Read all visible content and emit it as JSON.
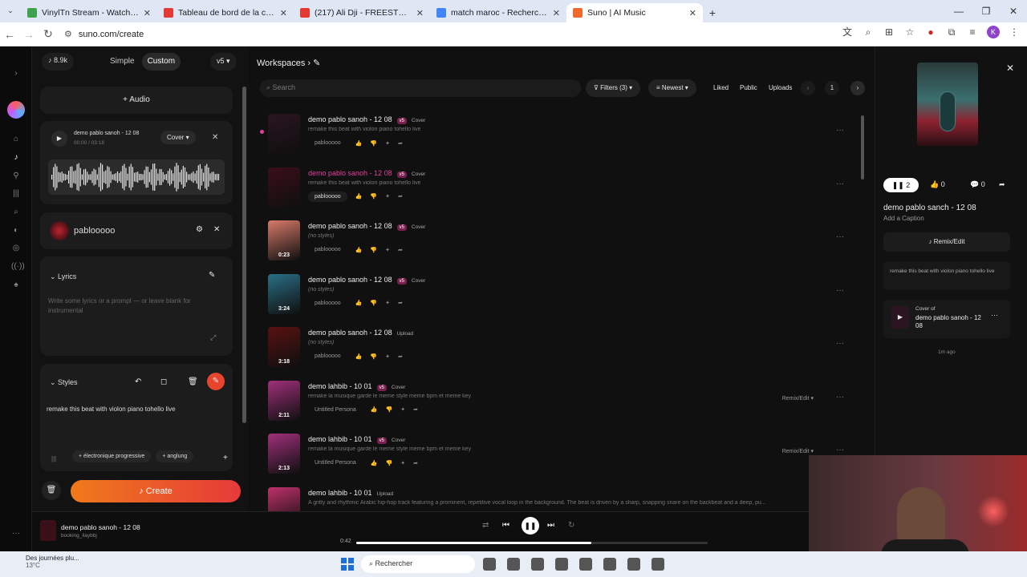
{
  "browser": {
    "tabs": [
      {
        "title": "VinylTn Stream - Watch Live on",
        "color": "#3fa34d",
        "active": false
      },
      {
        "title": "Tableau de bord de la chaîne - Y",
        "color": "#e53935",
        "active": false
      },
      {
        "title": "(217) Ali Dji - FREESTYLE 3 | SAI",
        "color": "#e53935",
        "active": false
      },
      {
        "title": "match maroc - Recherche Goog",
        "color": "#4285f4",
        "active": false
      },
      {
        "title": "Suno | AI Music",
        "color": "#f0692a",
        "active": true
      }
    ],
    "url": "suno.com/create",
    "profile_initial": "K"
  },
  "left_panel": {
    "credits": "8.9k",
    "mode_simple": "Simple",
    "mode_custom": "Custom",
    "version": "v5",
    "audio_button": "Audio",
    "audio_card": {
      "title": "demo pablo sanoh - 12 08",
      "time": "00:00 / 03:18",
      "mode": "Cover"
    },
    "persona_name": "pablooooo",
    "lyrics_label": "Lyrics",
    "lyrics_placeholder": "Write some lyrics or a prompt — or leave blank for instrumental",
    "styles_label": "Styles",
    "styles_text": "remake this beat with violon piano tohello live",
    "style_chips": [
      "électronique progressive",
      "anglung"
    ],
    "create_button": "Create"
  },
  "middle_panel": {
    "breadcrumb": "Workspaces",
    "search_placeholder": "Search",
    "filters": "Filters (3)",
    "sort": "Newest",
    "liked": "Liked",
    "public": "Public",
    "uploads": "Uploads",
    "page": "1",
    "songs": [
      {
        "title": "demo pablo sanoh - 12 08",
        "version": "v5",
        "type": "Cover",
        "desc": "remake this beat with violon piano tohello live",
        "user": "pablooooo",
        "duration": "",
        "highlight": false,
        "thumb": "#2a1520"
      },
      {
        "title": "demo pablo sanoh - 12 08",
        "version": "v5",
        "type": "Cover",
        "desc": "remake this beat with violon piano tohello live",
        "user": "pablooooo",
        "duration": "",
        "highlight": true,
        "thumb": "#3a0f18"
      },
      {
        "title": "demo pablo sanoh - 12 08",
        "version": "v5",
        "type": "Cover",
        "desc": "(no styles)",
        "user": "pablooooo",
        "duration": "0:23",
        "highlight": false,
        "thumb": "#d97a6a"
      },
      {
        "title": "demo pablo sanoh - 12 08",
        "version": "v5",
        "type": "Cover",
        "desc": "(no styles)",
        "user": "pablooooo",
        "duration": "3:24",
        "highlight": false,
        "thumb": "#2a6f86"
      },
      {
        "title": "demo pablo sanoh - 12 08",
        "version": "",
        "type": "Upload",
        "desc": "(no styles)",
        "user": "pablooooo",
        "duration": "3:18",
        "highlight": false,
        "thumb": "#5a1010"
      },
      {
        "title": "demo lahbib - 10 01",
        "version": "v5",
        "type": "Cover",
        "desc": "remake la musique garde le meme style meme bpm et meme key",
        "user": "Untitled Persona",
        "duration": "2:11",
        "highlight": false,
        "thumb": "#a0307a",
        "remix": "Remix/Edit"
      },
      {
        "title": "demo lahbib - 10 01",
        "version": "v5",
        "type": "Cover",
        "desc": "remake la musique garde le meme style meme bpm et meme key",
        "user": "Untitled Persona",
        "duration": "2:13",
        "highlight": false,
        "thumb": "#a0307a",
        "remix": "Remix/Edit"
      },
      {
        "title": "demo lahbib - 10 01",
        "version": "",
        "type": "Upload",
        "desc": "A gritty and rhythmic Arabic hip-hop track featuring a prominent, repetitive vocal loop in the background. The beat is driven by a sharp, snapping snare on the backbeat and a deep, pu...",
        "user": "",
        "duration": "",
        "highlight": false,
        "thumb": "#c0306a"
      }
    ]
  },
  "right_panel": {
    "plays": "2",
    "likes": "0",
    "comments": "0",
    "title": "demo pablo sanch - 12 08",
    "caption": "Add a Caption",
    "remix_button": "Remix/Edit",
    "prompt": "remake this beat with violon piano tohello live",
    "cover_of_label": "Cover of",
    "cover_of_title": "demo pablo sanoh - 12 08",
    "time_ago": "1m ago"
  },
  "player": {
    "title": "demo pablo sanoh - 12 08",
    "user": "booking_ilaybbj",
    "elapsed": "0:42",
    "progress": 0.67
  },
  "taskbar": {
    "weather_title": "Des journées plu...",
    "weather_temp": "13°C",
    "search_placeholder": "Rechercher"
  }
}
